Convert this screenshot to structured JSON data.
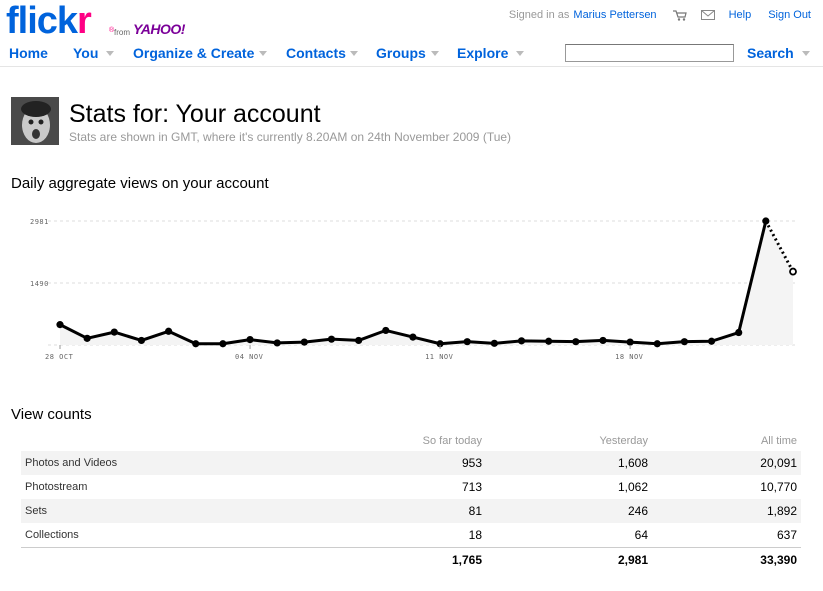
{
  "brand": {
    "logo_main": "flick",
    "logo_r": "r",
    "logo_reg": "®",
    "from": "from",
    "yahoo": "YAHOO!"
  },
  "topbar": {
    "signed_in_prefix": "Signed in as",
    "username": "Marius Pettersen",
    "cart_icon": "cart-icon",
    "mail_icon": "mail-icon",
    "help": "Help",
    "sign_out": "Sign Out"
  },
  "nav": {
    "items": [
      {
        "label": "Home"
      },
      {
        "label": "You"
      },
      {
        "label": "Organize & Create"
      },
      {
        "label": "Contacts"
      },
      {
        "label": "Groups"
      },
      {
        "label": "Explore"
      }
    ],
    "search_label": "Search",
    "search_value": ""
  },
  "page": {
    "title": "Stats for: Your account",
    "subtitle": "Stats are shown in GMT, where it's currently 8.20AM on 24th November 2009 (Tue)"
  },
  "chart_section": {
    "title": "Daily aggregate views on your account"
  },
  "chart_data": {
    "type": "line",
    "title": "Daily aggregate views on your account",
    "ylim": [
      0,
      2981
    ],
    "yticks": [
      {
        "label": "2981",
        "value": 2981
      },
      {
        "label": "1490",
        "value": 1490
      }
    ],
    "xticks": [
      {
        "label": "28 OCT",
        "index": 0
      },
      {
        "label": "04 NOV",
        "index": 7
      },
      {
        "label": "11 NOV",
        "index": 14
      },
      {
        "label": "18 NOV",
        "index": 21
      }
    ],
    "x": [
      "28 OCT",
      "29 OCT",
      "30 OCT",
      "31 OCT",
      "01 NOV",
      "02 NOV",
      "03 NOV",
      "04 NOV",
      "05 NOV",
      "06 NOV",
      "07 NOV",
      "08 NOV",
      "09 NOV",
      "10 NOV",
      "11 NOV",
      "12 NOV",
      "13 NOV",
      "14 NOV",
      "15 NOV",
      "16 NOV",
      "17 NOV",
      "18 NOV",
      "19 NOV",
      "20 NOV",
      "21 NOV",
      "22 NOV",
      "23 NOV",
      "24 NOV"
    ],
    "values": [
      490,
      160,
      310,
      110,
      330,
      30,
      30,
      130,
      50,
      70,
      140,
      110,
      350,
      190,
      30,
      80,
      40,
      100,
      90,
      80,
      110,
      70,
      30,
      80,
      90,
      300,
      2981,
      1765
    ],
    "partial_last_point": true,
    "grid": true,
    "line_color": "#000000",
    "fill_color": "#f4f4f4"
  },
  "counts_section": {
    "title": "View counts"
  },
  "view_counts": {
    "headers": [
      "So far today",
      "Yesterday",
      "All time"
    ],
    "rows": [
      {
        "label": "Photos and Videos",
        "today": "953",
        "yesterday": "1,608",
        "all": "20,091"
      },
      {
        "label": "Photostream",
        "today": "713",
        "yesterday": "1,062",
        "all": "10,770"
      },
      {
        "label": "Sets",
        "today": "81",
        "yesterday": "246",
        "all": "1,892"
      },
      {
        "label": "Collections",
        "today": "18",
        "yesterday": "64",
        "all": "637"
      }
    ],
    "totals": {
      "today": "1,765",
      "yesterday": "2,981",
      "all": "33,390"
    }
  }
}
